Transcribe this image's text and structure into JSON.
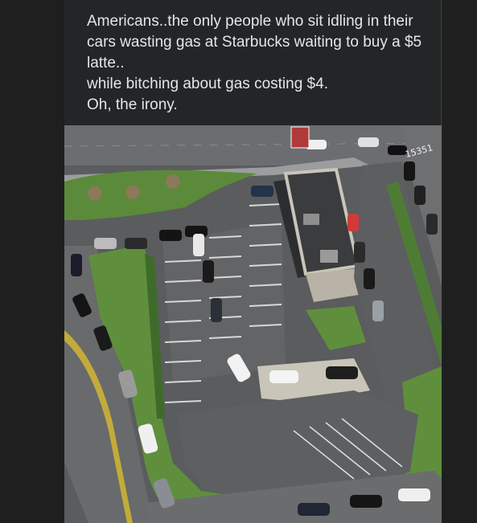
{
  "post": {
    "lines": [
      "Americans..the only people who sit idling in their",
      "cars wasting gas at Starbucks waiting to buy a $5",
      "latte..",
      "while bitching about gas costing $4.",
      "Oh, the irony."
    ]
  },
  "photo": {
    "sign_text": "15351",
    "icon": "aerial-photo"
  },
  "colors": {
    "background": "#1f1f1f",
    "card": "#242526",
    "text": "#e4e6eb"
  }
}
